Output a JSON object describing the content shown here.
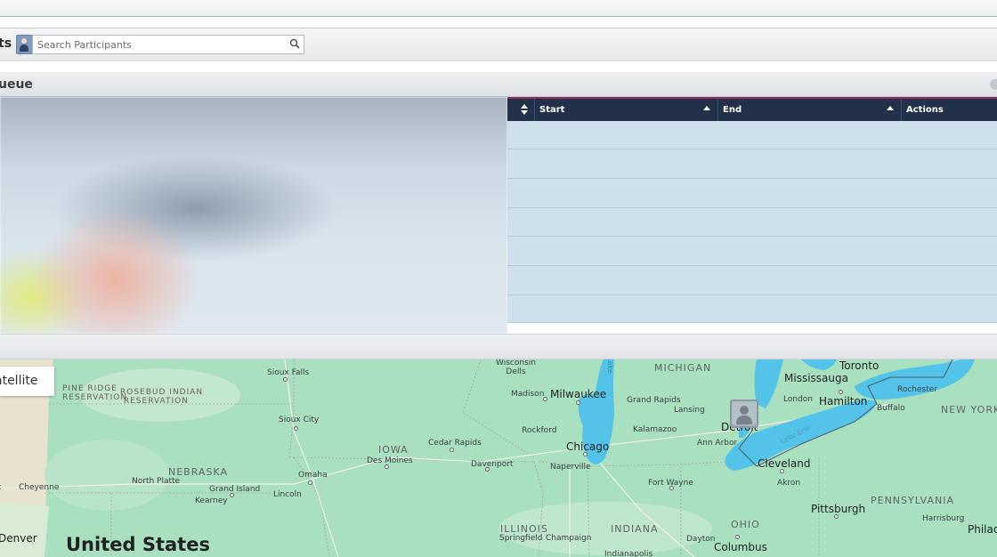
{
  "search": {
    "label": "ts",
    "placeholder": "Search Participants",
    "value": ""
  },
  "panel": {
    "title": "ueue"
  },
  "grid": {
    "columns": [
      {
        "label": ""
      },
      {
        "label": "Start"
      },
      {
        "label": "End"
      },
      {
        "label": "Actions"
      }
    ],
    "row_count": 7
  },
  "map": {
    "satellite_label": "atellite",
    "labels": {
      "michigan": "MICHIGAN",
      "wisconsin_dells": "Wisconsin\nDells",
      "sioux_falls": "Sioux Falls",
      "pine_ridge": "PINE RIDGE\nRESERVATION",
      "rosebud": "ROSEBUD INDIAN\nRESERVATION",
      "madison": "Madison",
      "milwaukee": "Milwaukee",
      "grand_rapids": "Grand Rapids",
      "lansing": "Lansing",
      "mississauga": "Mississauga",
      "toronto": "Toronto",
      "london": "London",
      "hamilton": "Hamilton",
      "rochester": "Rochester",
      "buffalo": "Buffalo",
      "new_york": "NEW YORK",
      "sioux_city": "Sioux City",
      "iowa": "IOWA",
      "cedar_rapids": "Cedar Rapids",
      "rockford": "Rockford",
      "kalamazoo": "Kalamazoo",
      "ann_arbor": "Ann Arbor",
      "detroit": "Detroit",
      "chicago": "Chicago",
      "des_moines": "Des Moines",
      "davenport": "Davenport",
      "naperville": "Naperville",
      "cleveland": "Cleveland",
      "nebraska": "NEBRASKA",
      "north_platte": "North Platte",
      "omaha": "Omaha",
      "cheyenne": "Cheyenne",
      "grand_island": "Grand Island",
      "kearney": "Kearney",
      "lincoln": "Lincoln",
      "fort_wayne": "Fort Wayne",
      "akron": "Akron",
      "pittsburgh": "Pittsburgh",
      "pennsylvania": "PENNSYLVANIA",
      "harrisburg": "Harrisburg",
      "philad": "Philad",
      "illinois": "ILLINOIS",
      "springfield": "Springfield",
      "champaign": "Champaign",
      "indiana": "INDIANA",
      "ohio": "OHIO",
      "dayton": "Dayton",
      "columbus": "Columbus",
      "indianapolis": "Indianapolis",
      "denver": "Denver",
      "united_states": "United States",
      "lake_erie": "Lake Erie",
      "lake_michigan": "Lake"
    }
  },
  "colors": {
    "grid_header": "#223149",
    "grid_body": "#cfe0ed",
    "map_land": "#a9e0bf",
    "map_water": "#53c3ea"
  }
}
